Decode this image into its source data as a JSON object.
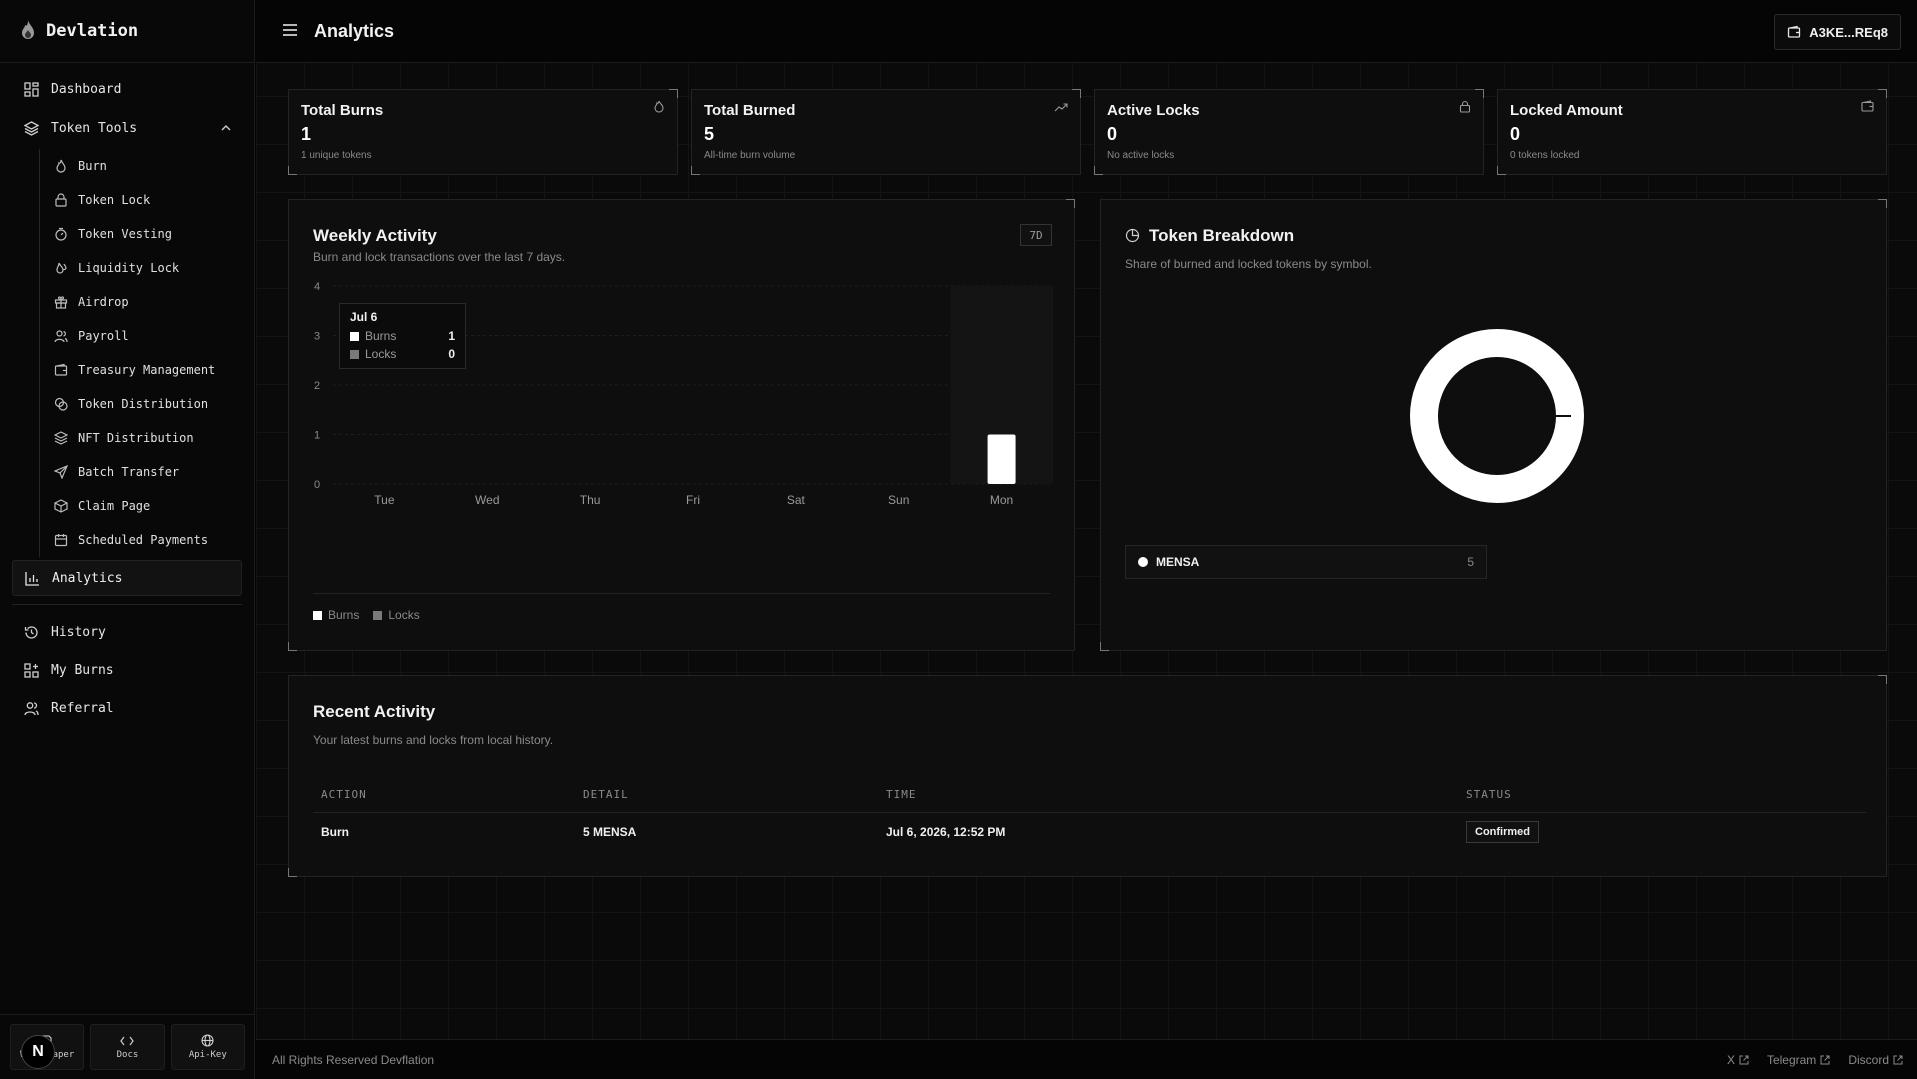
{
  "app": {
    "brand": "Devlation"
  },
  "sidebar": {
    "dashboard": "Dashboard",
    "group_label": "Token Tools",
    "tools": [
      {
        "label": "Burn",
        "icon": "flame-icon"
      },
      {
        "label": "Token Lock",
        "icon": "lock-icon"
      },
      {
        "label": "Token Vesting",
        "icon": "timer-icon"
      },
      {
        "label": "Liquidity Lock",
        "icon": "droplet-icon"
      },
      {
        "label": "Airdrop",
        "icon": "gift-icon"
      },
      {
        "label": "Payroll",
        "icon": "users-icon"
      },
      {
        "label": "Treasury Management",
        "icon": "wallet-icon"
      },
      {
        "label": "Token Distribution",
        "icon": "coins-icon"
      },
      {
        "label": "NFT Distribution",
        "icon": "layers-icon"
      },
      {
        "label": "Batch Transfer",
        "icon": "send-icon"
      },
      {
        "label": "Claim Page",
        "icon": "package-icon"
      },
      {
        "label": "Scheduled Payments",
        "icon": "calendar-icon"
      }
    ],
    "analytics": "Analytics",
    "history": "History",
    "my_burns": "My Burns",
    "referral": "Referral",
    "footer": {
      "whitepaper": "Whitepaper",
      "docs": "Docs",
      "api_key": "Api-Key",
      "avatar_letter": "N"
    }
  },
  "header": {
    "title": "Analytics",
    "wallet": "A3KE...REq8"
  },
  "stats": [
    {
      "title": "Total Burns",
      "value": "1",
      "sub": "1 unique tokens",
      "icon": "flame-icon"
    },
    {
      "title": "Total Burned",
      "value": "5",
      "sub": "All-time burn volume",
      "icon": "trending-up-icon"
    },
    {
      "title": "Active Locks",
      "value": "0",
      "sub": "No active locks",
      "icon": "lock-icon"
    },
    {
      "title": "Locked Amount",
      "value": "0",
      "sub": "0 tokens locked",
      "icon": "wallet-icon"
    }
  ],
  "weekly": {
    "title": "Weekly Activity",
    "subtitle": "Burn and lock transactions over the last 7 days.",
    "range": "7D",
    "tooltip": {
      "date": "Jul 6",
      "burns_label": "Burns",
      "burns": "1",
      "locks_label": "Locks",
      "locks": "0"
    },
    "legend": {
      "burns": "Burns",
      "locks": "Locks"
    }
  },
  "chart_data": {
    "type": "bar",
    "categories": [
      "Tue",
      "Wed",
      "Thu",
      "Fri",
      "Sat",
      "Sun",
      "Mon"
    ],
    "series": [
      {
        "name": "Burns",
        "values": [
          0,
          0,
          0,
          0,
          0,
          0,
          1
        ]
      },
      {
        "name": "Locks",
        "values": [
          0,
          0,
          0,
          0,
          0,
          0,
          0
        ]
      }
    ],
    "ylim": [
      0,
      4
    ],
    "yticks": [
      "0",
      "1",
      "2",
      "3",
      "4"
    ],
    "grid": true,
    "legend": "bottom-left"
  },
  "breakdown": {
    "title": "Token Breakdown",
    "subtitle": "Share of burned and locked tokens by symbol.",
    "items": [
      {
        "symbol": "MENSA",
        "value": "5"
      }
    ]
  },
  "recent": {
    "title": "Recent Activity",
    "subtitle": "Your latest burns and locks from local history.",
    "columns": [
      "ACTION",
      "DETAIL",
      "TIME",
      "STATUS"
    ],
    "rows": [
      {
        "action": "Burn",
        "detail": "5 MENSA",
        "time": "Jul 6, 2026, 12:52 PM",
        "status": "Confirmed"
      }
    ]
  },
  "footer": {
    "copyright": "All Rights Reserved Devflation",
    "links": [
      "X",
      "Telegram",
      "Discord"
    ]
  },
  "colors": {
    "accent": "#ffffff",
    "locks": "#7a7a7a",
    "background": "#0a0a0a"
  }
}
